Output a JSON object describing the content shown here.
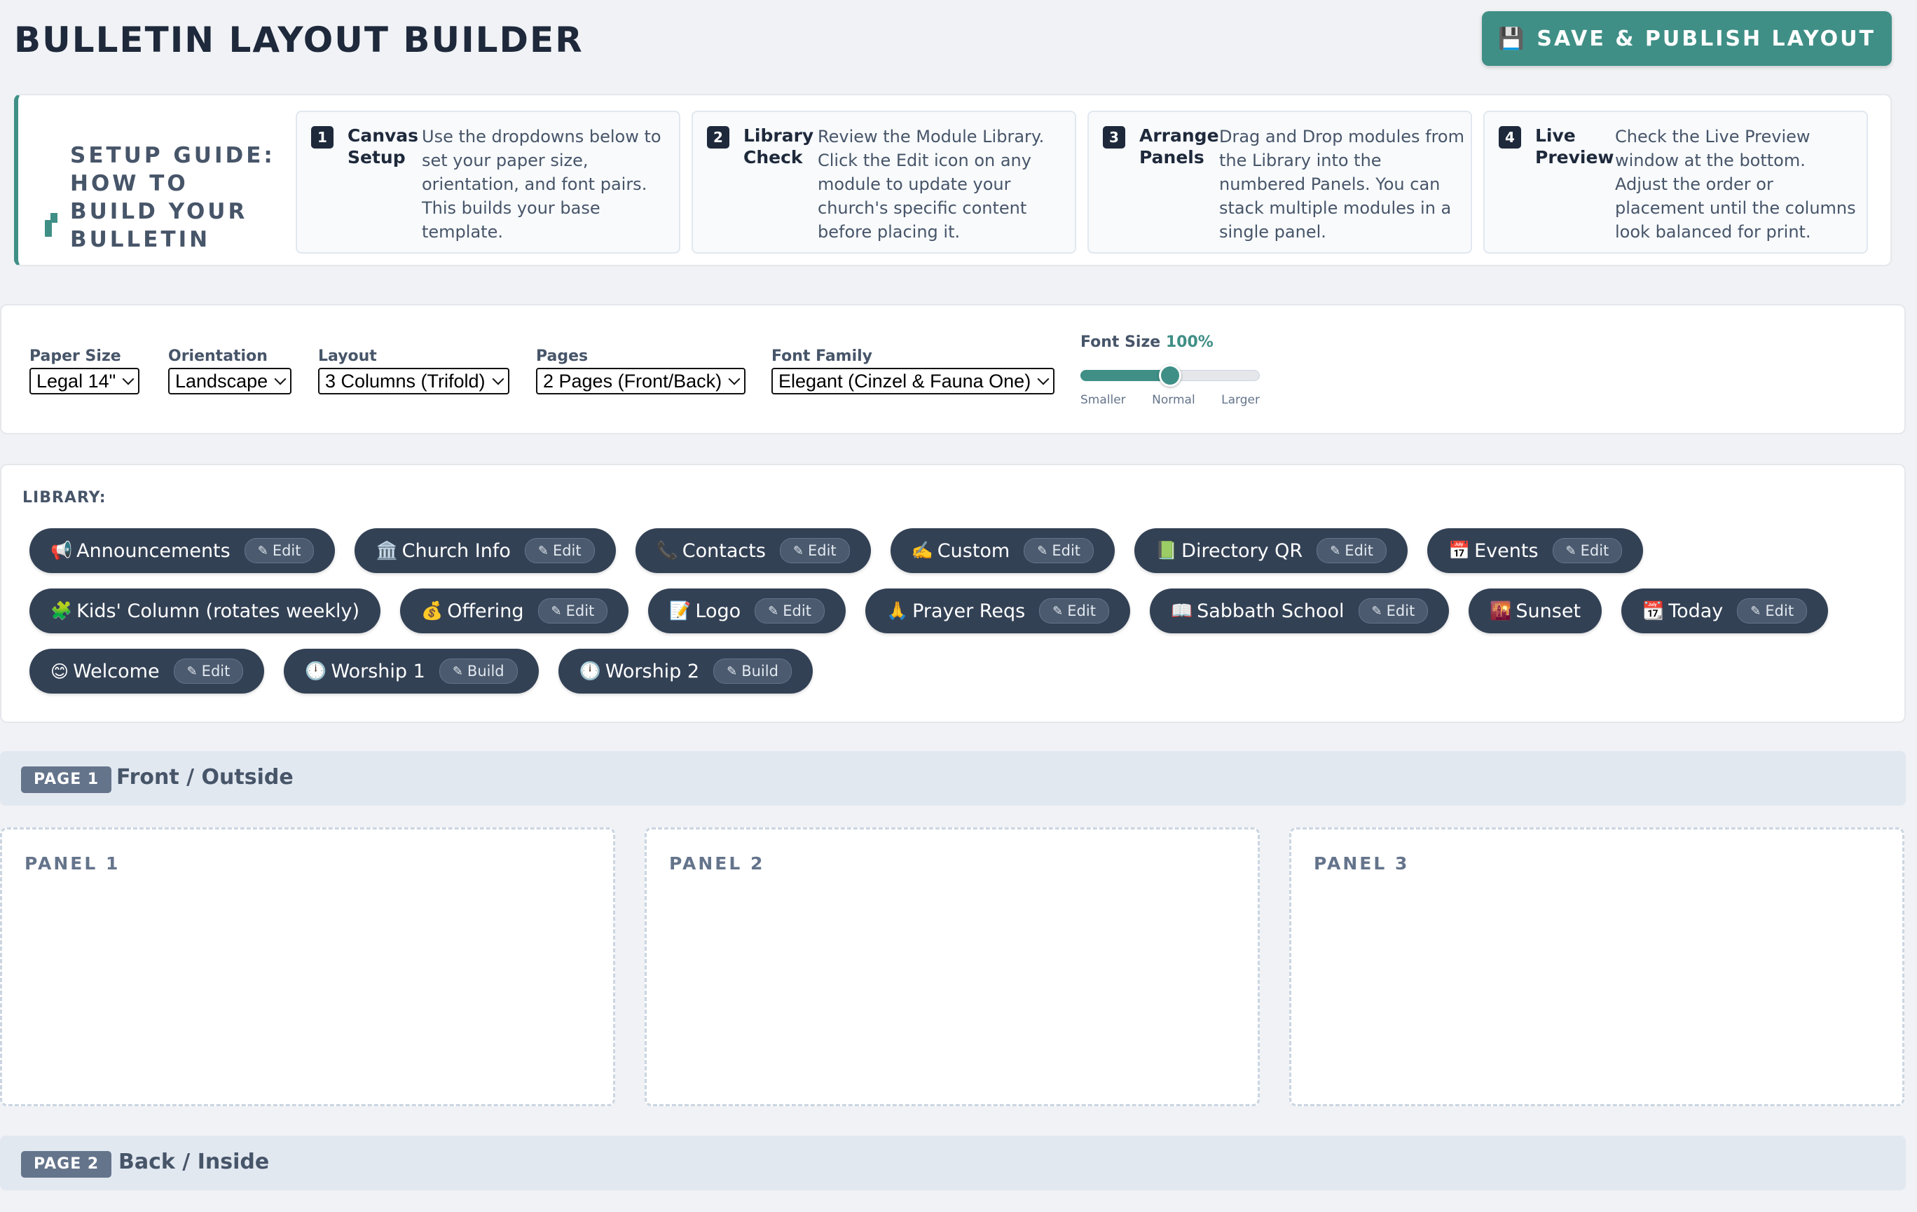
{
  "header": {
    "title": "BULLETIN LAYOUT BUILDER",
    "save_icon": "💾",
    "save_label": "SAVE & PUBLISH LAYOUT"
  },
  "guide": {
    "title": "SETUP GUIDE: HOW TO BUILD YOUR BULLETIN",
    "steps": [
      {
        "num": "1",
        "title": "Canvas Setup",
        "desc": "Use the dropdowns below to set your paper size, orientation, and font pairs. This builds your base template."
      },
      {
        "num": "2",
        "title": "Library Check",
        "desc": "Review the Module Library. Click the Edit icon on any module to update your church's specific content before placing it."
      },
      {
        "num": "3",
        "title": "Arrange Panels",
        "desc": "Drag and Drop modules from the Library into the numbered Panels. You can stack multiple modules in a single panel."
      },
      {
        "num": "4",
        "title": "Live Preview",
        "desc": "Check the Live Preview window at the bottom. Adjust the order or placement until the columns look balanced for print."
      }
    ]
  },
  "settings": {
    "paper_size": {
      "label": "Paper Size",
      "value": "Legal 14\""
    },
    "orientation": {
      "label": "Orientation",
      "value": "Landscape"
    },
    "layout": {
      "label": "Layout",
      "value": "3 Columns (Trifold)"
    },
    "pages": {
      "label": "Pages",
      "value": "2 Pages (Front/Back)"
    },
    "font_family": {
      "label": "Font Family",
      "value": "Elegant (Cinzel & Fauna One)"
    },
    "font_size": {
      "label": "Font Size",
      "value": "100%",
      "level": 0.5,
      "marks": [
        "Smaller",
        "Normal",
        "Larger"
      ]
    }
  },
  "library": {
    "label": "LIBRARY:",
    "modules": [
      {
        "icon": "📢",
        "name": "Announcements",
        "action": "Edit"
      },
      {
        "icon": "🏛️",
        "name": "Church Info",
        "action": "Edit"
      },
      {
        "icon": "📞",
        "name": "Contacts",
        "action": "Edit"
      },
      {
        "icon": "✍️",
        "name": "Custom",
        "action": "Edit"
      },
      {
        "icon": "📗",
        "name": "Directory QR",
        "action": "Edit"
      },
      {
        "icon": "📅",
        "name": "Events",
        "action": "Edit"
      },
      {
        "icon": "🧩",
        "name": "Kids' Column (rotates weekly)",
        "action": ""
      },
      {
        "icon": "💰",
        "name": "Offering",
        "action": "Edit"
      },
      {
        "icon": "📝",
        "name": "Logo",
        "action": "Edit"
      },
      {
        "icon": "🙏",
        "name": "Prayer Reqs",
        "action": "Edit"
      },
      {
        "icon": "📖",
        "name": "Sabbath School",
        "action": "Edit"
      },
      {
        "icon": "🌇",
        "name": "Sunset",
        "action": ""
      },
      {
        "icon": "📆",
        "name": "Today",
        "action": "Edit"
      },
      {
        "icon": "😊",
        "name": "Welcome",
        "action": "Edit"
      },
      {
        "icon": "🕛",
        "name": "Worship 1",
        "action": "Build"
      },
      {
        "icon": "🕛",
        "name": "Worship 2",
        "action": "Build"
      }
    ]
  },
  "pages": [
    {
      "badge": "PAGE 1",
      "name": "Front / Outside",
      "panels": [
        "PANEL 1",
        "PANEL 2",
        "PANEL 3"
      ]
    },
    {
      "badge": "PAGE 2",
      "name": "Back / Inside"
    }
  ],
  "colors": {
    "accent": "#3f8f86",
    "chip": "#334155",
    "page_bar": "#e2e8f0"
  }
}
